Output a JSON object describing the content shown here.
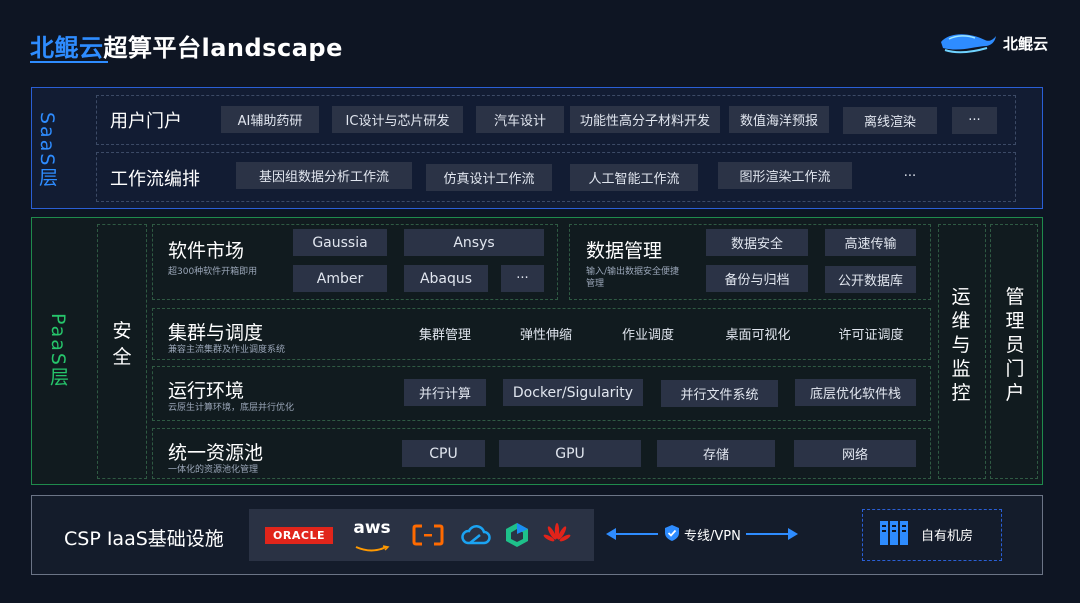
{
  "header": {
    "title_brand": "北鲲云",
    "title_rest": "超算平台landscape",
    "logo_text": "北鲲云"
  },
  "saas": {
    "label": "SaaS层",
    "rows": [
      {
        "title": "用户门户",
        "chips": [
          "AI辅助药研",
          "IC设计与芯片研发",
          "汽车设计",
          "功能性高分子材料开发",
          "数值海洋预报",
          "离线渲染",
          "···"
        ]
      },
      {
        "title": "工作流编排",
        "chips": [
          "基因组数据分析工作流",
          "仿真设计工作流",
          "人工智能工作流",
          "图形渲染工作流",
          "···"
        ]
      }
    ]
  },
  "paas": {
    "label": "PaaS层",
    "security": "安全",
    "ops": "运维与监控",
    "admin": "管理员门户",
    "software_market": {
      "title": "软件市场",
      "desc": "超300种软件开箱即用",
      "chips": [
        "Gaussia",
        "Ansys",
        "Amber",
        "Abaqus",
        "···"
      ]
    },
    "data_mgmt": {
      "title": "数据管理",
      "desc_line1": "输入/输出数据安全便捷",
      "desc_line2": "管理",
      "chips": [
        "数据安全",
        "高速传输",
        "备份与归档",
        "公开数据库"
      ]
    },
    "cluster": {
      "title": "集群与调度",
      "desc": "兼容主流集群及作业调度系统",
      "chips": [
        "集群管理",
        "弹性伸缩",
        "作业调度",
        "桌面可视化",
        "许可证调度"
      ]
    },
    "runtime": {
      "title": "运行环境",
      "desc": "云原生计算环境，底层并行优化",
      "chips": [
        "并行计算",
        "Docker/Sigularity",
        "并行文件系统",
        "底层优化软件栈"
      ]
    },
    "pool": {
      "title": "统一资源池",
      "desc": "一体化的资源池化管理",
      "chips": [
        "CPU",
        "GPU",
        "存储",
        "网络"
      ]
    }
  },
  "iaas": {
    "title": "CSP IaaS基础设施",
    "providers": [
      "ORACLE",
      "aws"
    ],
    "provider_icons": [
      "aliyun-icon",
      "tencent-cloud-icon",
      "qingcloud-icon",
      "huawei-icon"
    ],
    "vpn": "专线/VPN",
    "own_room": "自有机房"
  },
  "colors": {
    "blue": "#2e8cff",
    "green": "#26c56b",
    "oracle_red": "#e1251b",
    "aws_orange": "#ff9900"
  }
}
